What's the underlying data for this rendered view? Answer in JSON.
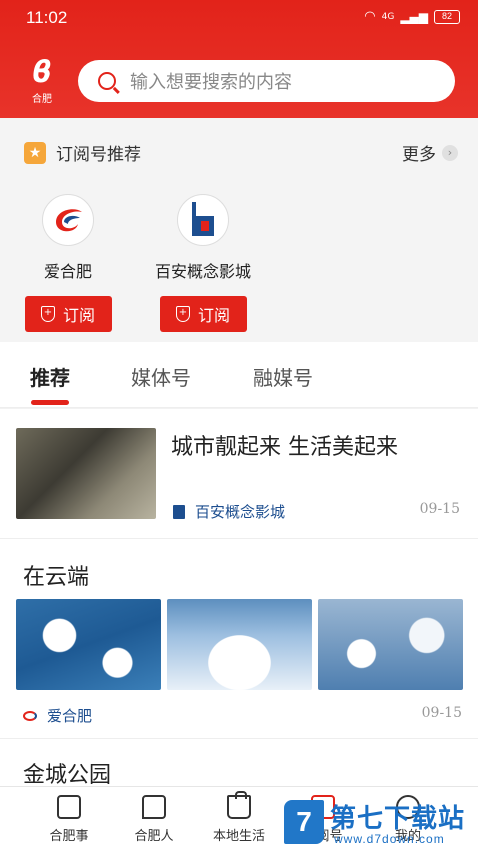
{
  "status_bar": {
    "time": "11:02",
    "battery": "82",
    "network": "4G"
  },
  "header": {
    "logo_label": "合肥",
    "search_placeholder": "输入想要搜索的内容"
  },
  "subscriptions": {
    "title": "订阅号推荐",
    "more_label": "更多",
    "accounts": [
      {
        "name": "爱合肥",
        "button": "订阅"
      },
      {
        "name": "百安概念影城",
        "button": "订阅"
      }
    ]
  },
  "tabs": [
    {
      "label": "推荐",
      "active": true
    },
    {
      "label": "媒体号",
      "active": false
    },
    {
      "label": "融媒号",
      "active": false
    }
  ],
  "feed": [
    {
      "title": "城市靓起来 生活美起来",
      "source": "百安概念影城",
      "date": "09-15"
    },
    {
      "title": "在云端",
      "source": "爱合肥",
      "date": "09-15"
    },
    {
      "title": "金城公园"
    }
  ],
  "bottom_nav": [
    {
      "label": "合肥事",
      "icon": "document-icon"
    },
    {
      "label": "合肥人",
      "icon": "chat-icon"
    },
    {
      "label": "本地生活",
      "icon": "bag-icon"
    },
    {
      "label": "订阅号",
      "icon": "subscribe-icon"
    },
    {
      "label": "我的",
      "icon": "profile-icon"
    }
  ],
  "watermark": {
    "text": "第七下载站",
    "url": "www.d7down.com",
    "mark": "7"
  },
  "colors": {
    "brand_red": "#e2231a",
    "link_blue": "#1d4e8f"
  }
}
